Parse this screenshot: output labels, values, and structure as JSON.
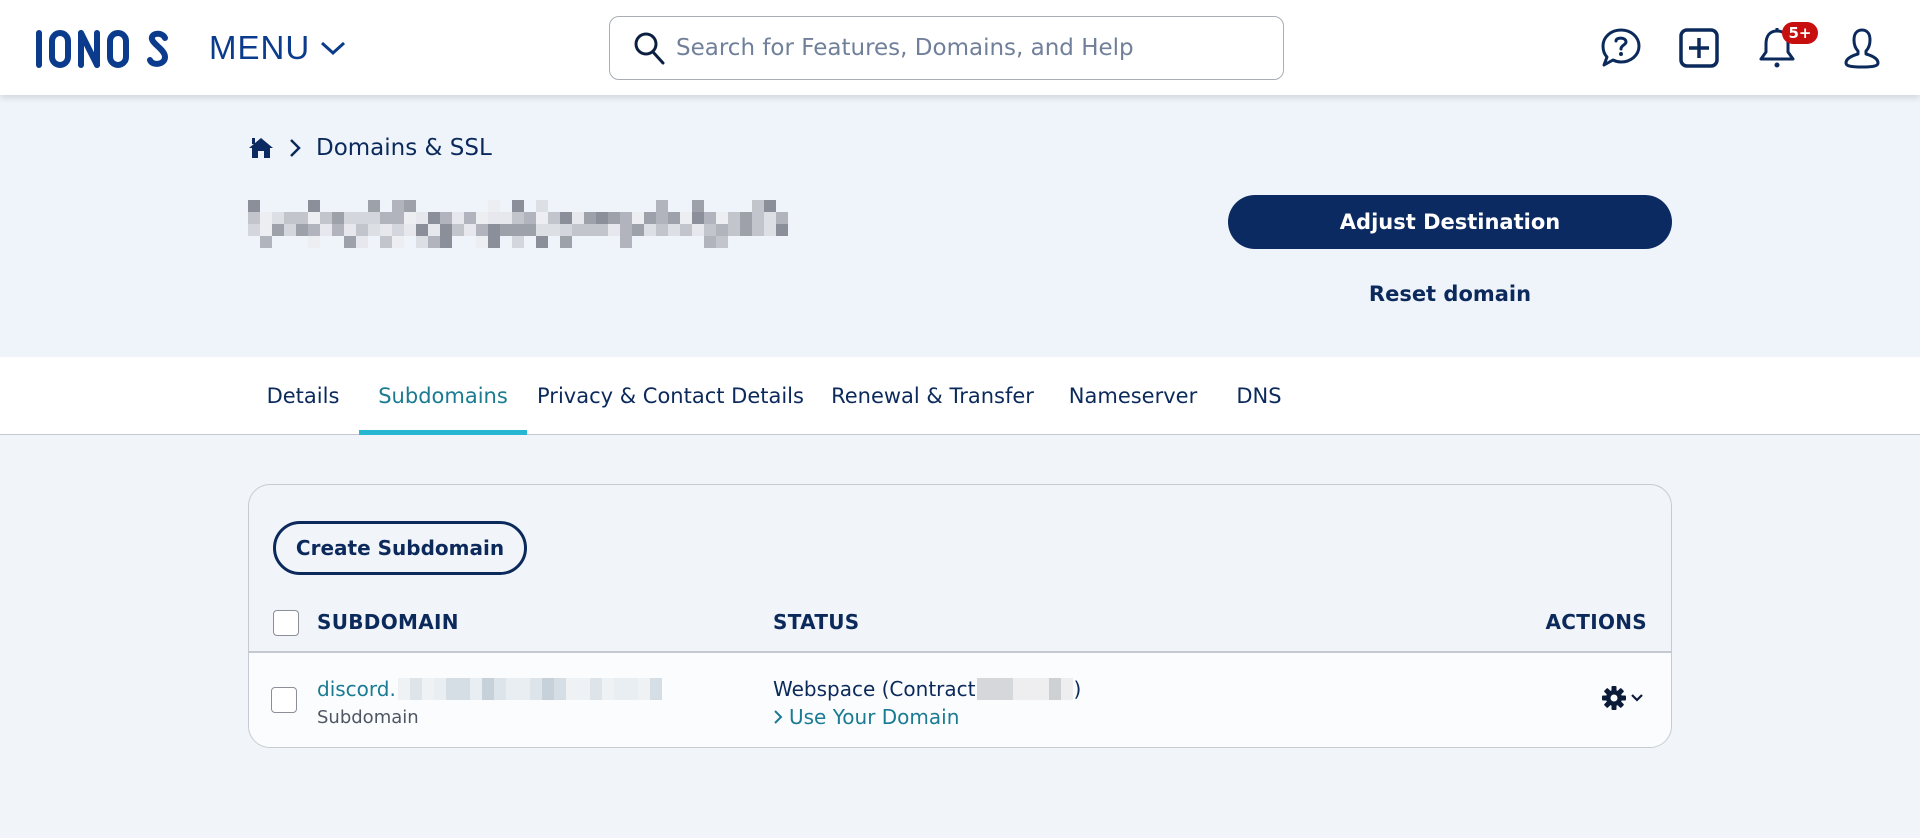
{
  "header": {
    "logo_text": "IONOS",
    "menu_label": "MENU",
    "search_placeholder": "Search for Features, Domains, and Help",
    "icons": [
      "help-chat-icon",
      "add-square-icon",
      "bell-icon",
      "user-icon"
    ],
    "notification_badge": "5+"
  },
  "breadcrumb": {
    "home_icon": "home-icon",
    "items": [
      "Domains & SSL"
    ]
  },
  "domain": {
    "title": "[redacted domain name]",
    "adjust_destination_label": "Adjust Destination",
    "reset_domain_label": "Reset domain"
  },
  "tabs": [
    {
      "label": "Details",
      "active": false
    },
    {
      "label": "Subdomains",
      "active": true
    },
    {
      "label": "Privacy & Contact Details",
      "active": false
    },
    {
      "label": "Renewal & Transfer",
      "active": false
    },
    {
      "label": "Nameserver",
      "active": false
    },
    {
      "label": "DNS",
      "active": false
    }
  ],
  "subdomains": {
    "create_label": "Create Subdomain",
    "columns": [
      "SUBDOMAIN",
      "STATUS",
      "ACTIONS"
    ],
    "rows": [
      {
        "name_prefix": "discord.",
        "name_redacted": true,
        "type": "Subdomain",
        "status": "Webspace (Contract",
        "status_suffix": ")",
        "status_redacted": true,
        "status_link": "Use Your Domain",
        "actions_icon": "gear-icon"
      }
    ]
  },
  "colors": {
    "brand_navy": "#0b2a62",
    "link_teal": "#1a7b92",
    "tab_underline": "#27b7d3",
    "badge_red": "#c80f0f"
  }
}
